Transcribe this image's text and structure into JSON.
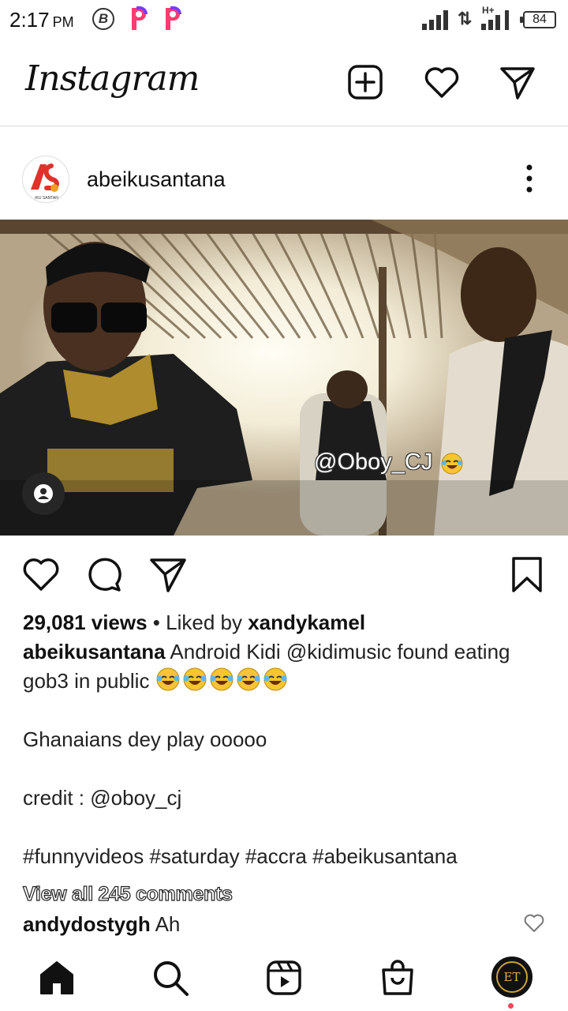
{
  "status_bar": {
    "time": "2:17",
    "ampm": "PM",
    "battery": "84"
  },
  "header": {
    "logo": "Instagram",
    "icons": [
      "new-post-icon",
      "heart-icon",
      "direct-message-icon"
    ]
  },
  "post": {
    "username": "abeikusantana",
    "avatar_text": "AS",
    "avatar_subtext": "IKU SANTAN",
    "video_overlay": "@Oboy_CJ",
    "views": "29,081 views",
    "liked_by_prefix": " • Liked by ",
    "liked_by_user": "xandykamel",
    "caption_user": "abeikusantana",
    "caption_line1": " Android Kidi @kidimusic found eating gob3 in public",
    "caption_line2": "Ghanaians dey play ooooo",
    "caption_line3": "credit : @oboy_cj",
    "caption_hashtags": "#funnyvideos #saturday #accra #abeikusantana",
    "view_comments": "View all 245 comments",
    "comment_user": "andydostygh",
    "comment_text": " Ah"
  },
  "bottom_nav": {
    "items": [
      "home-icon",
      "search-icon",
      "reels-icon",
      "shop-icon",
      "profile-avatar"
    ],
    "profile_text": "ET"
  },
  "colors": {
    "text": "#111111",
    "divider": "#dbdbdb",
    "notification_dot": "#ed4956",
    "avatar_red": "#e0312b"
  }
}
